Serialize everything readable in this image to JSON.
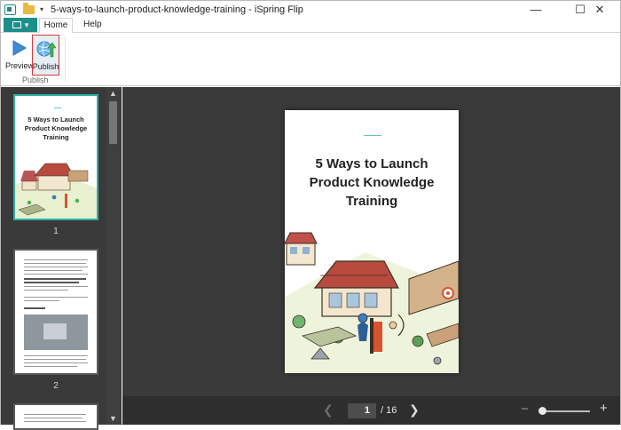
{
  "window": {
    "title": "5-ways-to-launch-product-knowledge-training - iSpring Flip",
    "qat_label": "▾",
    "controls": {
      "minimize": "—",
      "maximize": "☐",
      "close": "✕"
    }
  },
  "ribbon": {
    "file_label": "▾",
    "tabs": [
      {
        "label": "Home"
      },
      {
        "label": "Help"
      }
    ],
    "buttons": {
      "preview": "Preview",
      "publish": "Publish"
    },
    "group_label": "Publish"
  },
  "thumbnails": [
    {
      "page": "1",
      "title_lines": [
        "5 Ways to Launch",
        "Product Knowledge",
        "Training"
      ]
    },
    {
      "page": "2"
    }
  ],
  "page": {
    "title_lines": [
      "5 Ways to Launch",
      "Product Knowledge",
      "Training"
    ]
  },
  "navigation": {
    "current_page": "1",
    "total_label": "/ 16",
    "prev": "❮",
    "next": "❯",
    "zoom_out": "−",
    "zoom_in": "+",
    "zoom_level": 0
  },
  "colors": {
    "accent": "#1d8f8a",
    "highlight": "#d23a3a"
  }
}
